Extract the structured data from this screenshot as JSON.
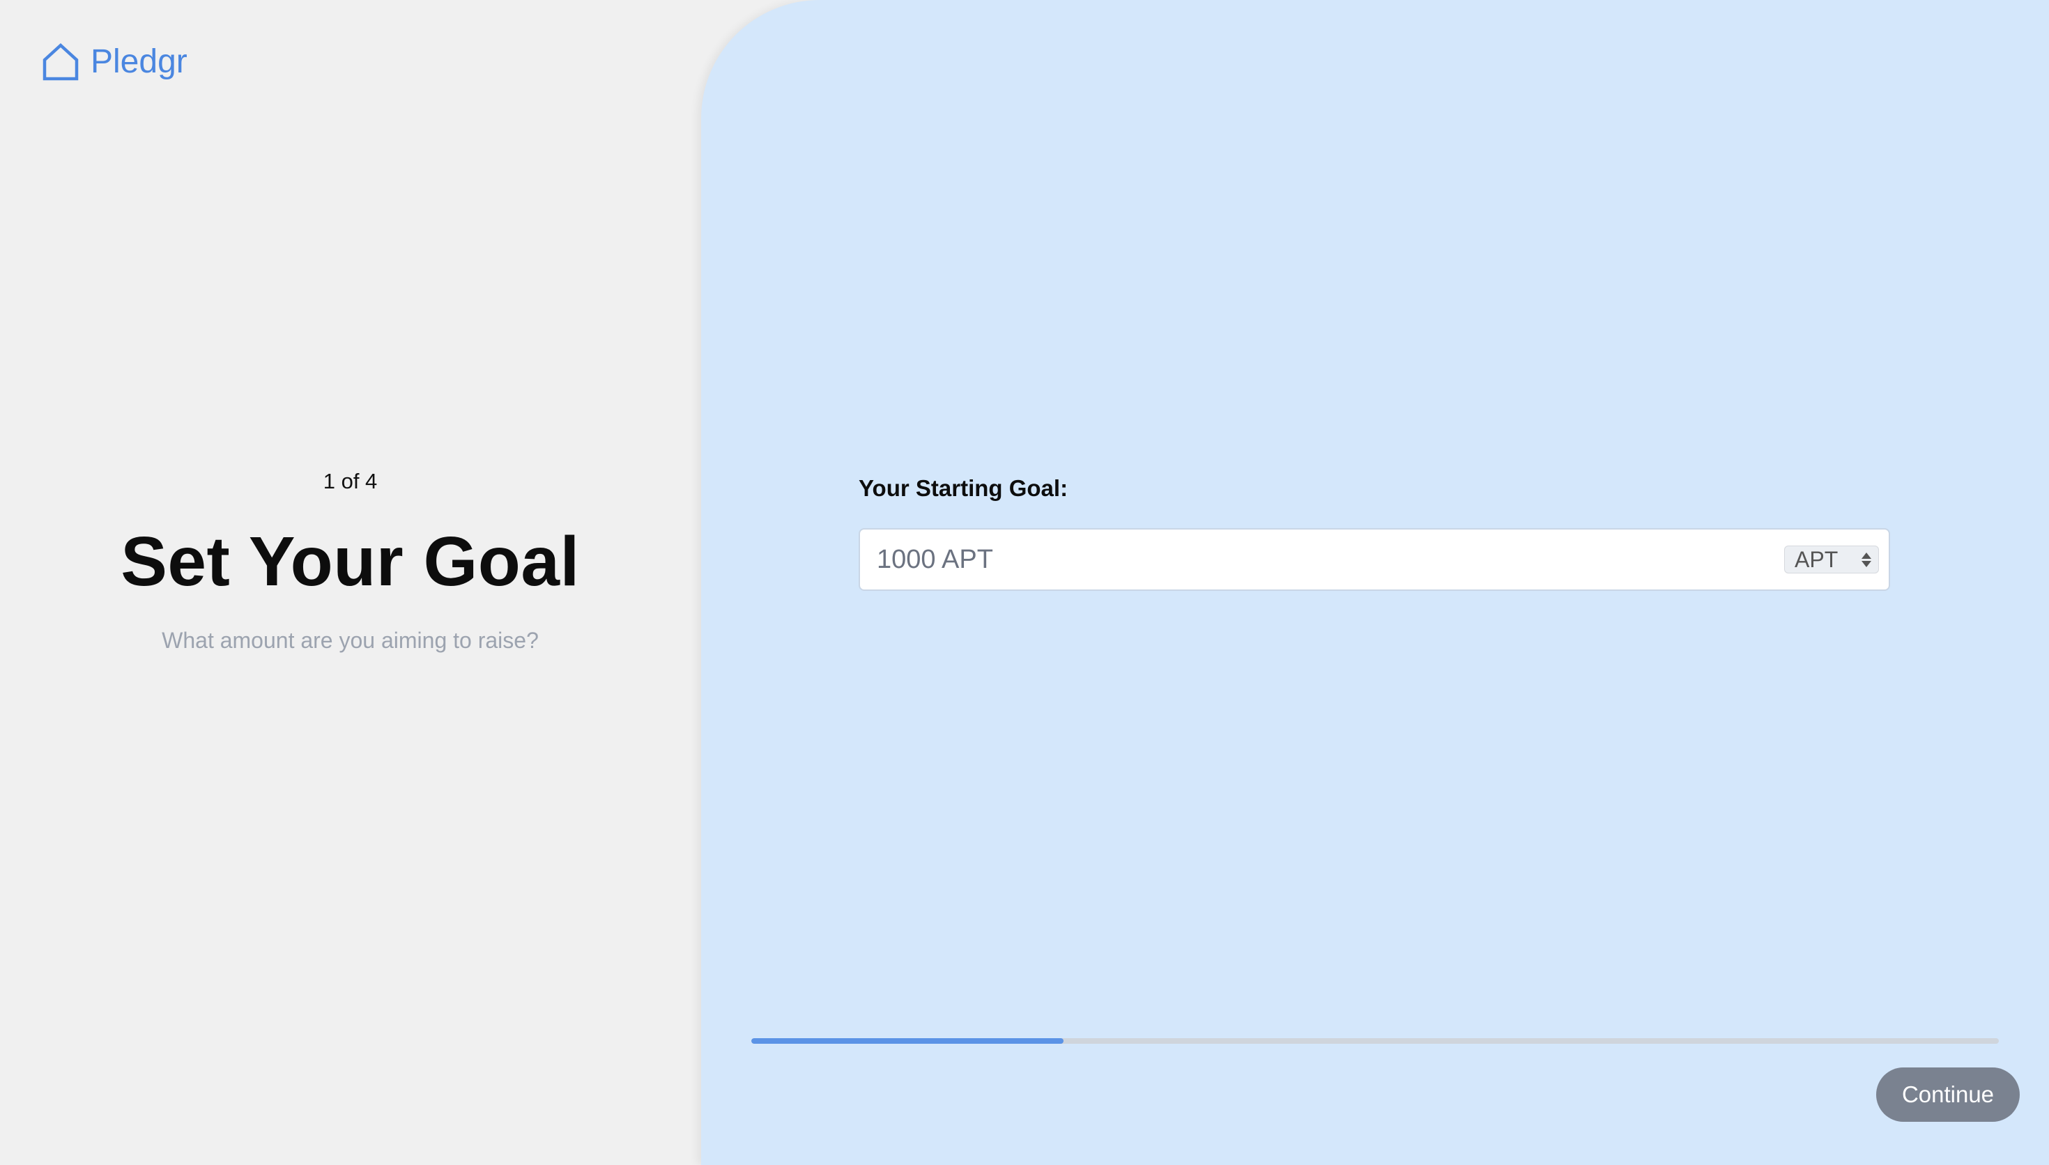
{
  "brand": {
    "name": "Pledgr",
    "icon": "home-icon",
    "color": "#4a86e0"
  },
  "step": {
    "counter": "1 of 4",
    "current": 1,
    "total": 4,
    "title": "Set Your Goal",
    "subtitle": "What amount are you aiming to raise?"
  },
  "goal": {
    "label": "Your Starting Goal:",
    "placeholder": "1000 APT",
    "value": "",
    "currency": {
      "selected": "APT"
    }
  },
  "progress": {
    "fraction": 0.25,
    "fill_color": "#5b93e6",
    "track_color": "#cfd5dc"
  },
  "actions": {
    "continue_label": "Continue"
  },
  "colors": {
    "left_background": "#f0f0f0",
    "right_background": "#d4e7fb",
    "button_background": "#7a8290"
  }
}
